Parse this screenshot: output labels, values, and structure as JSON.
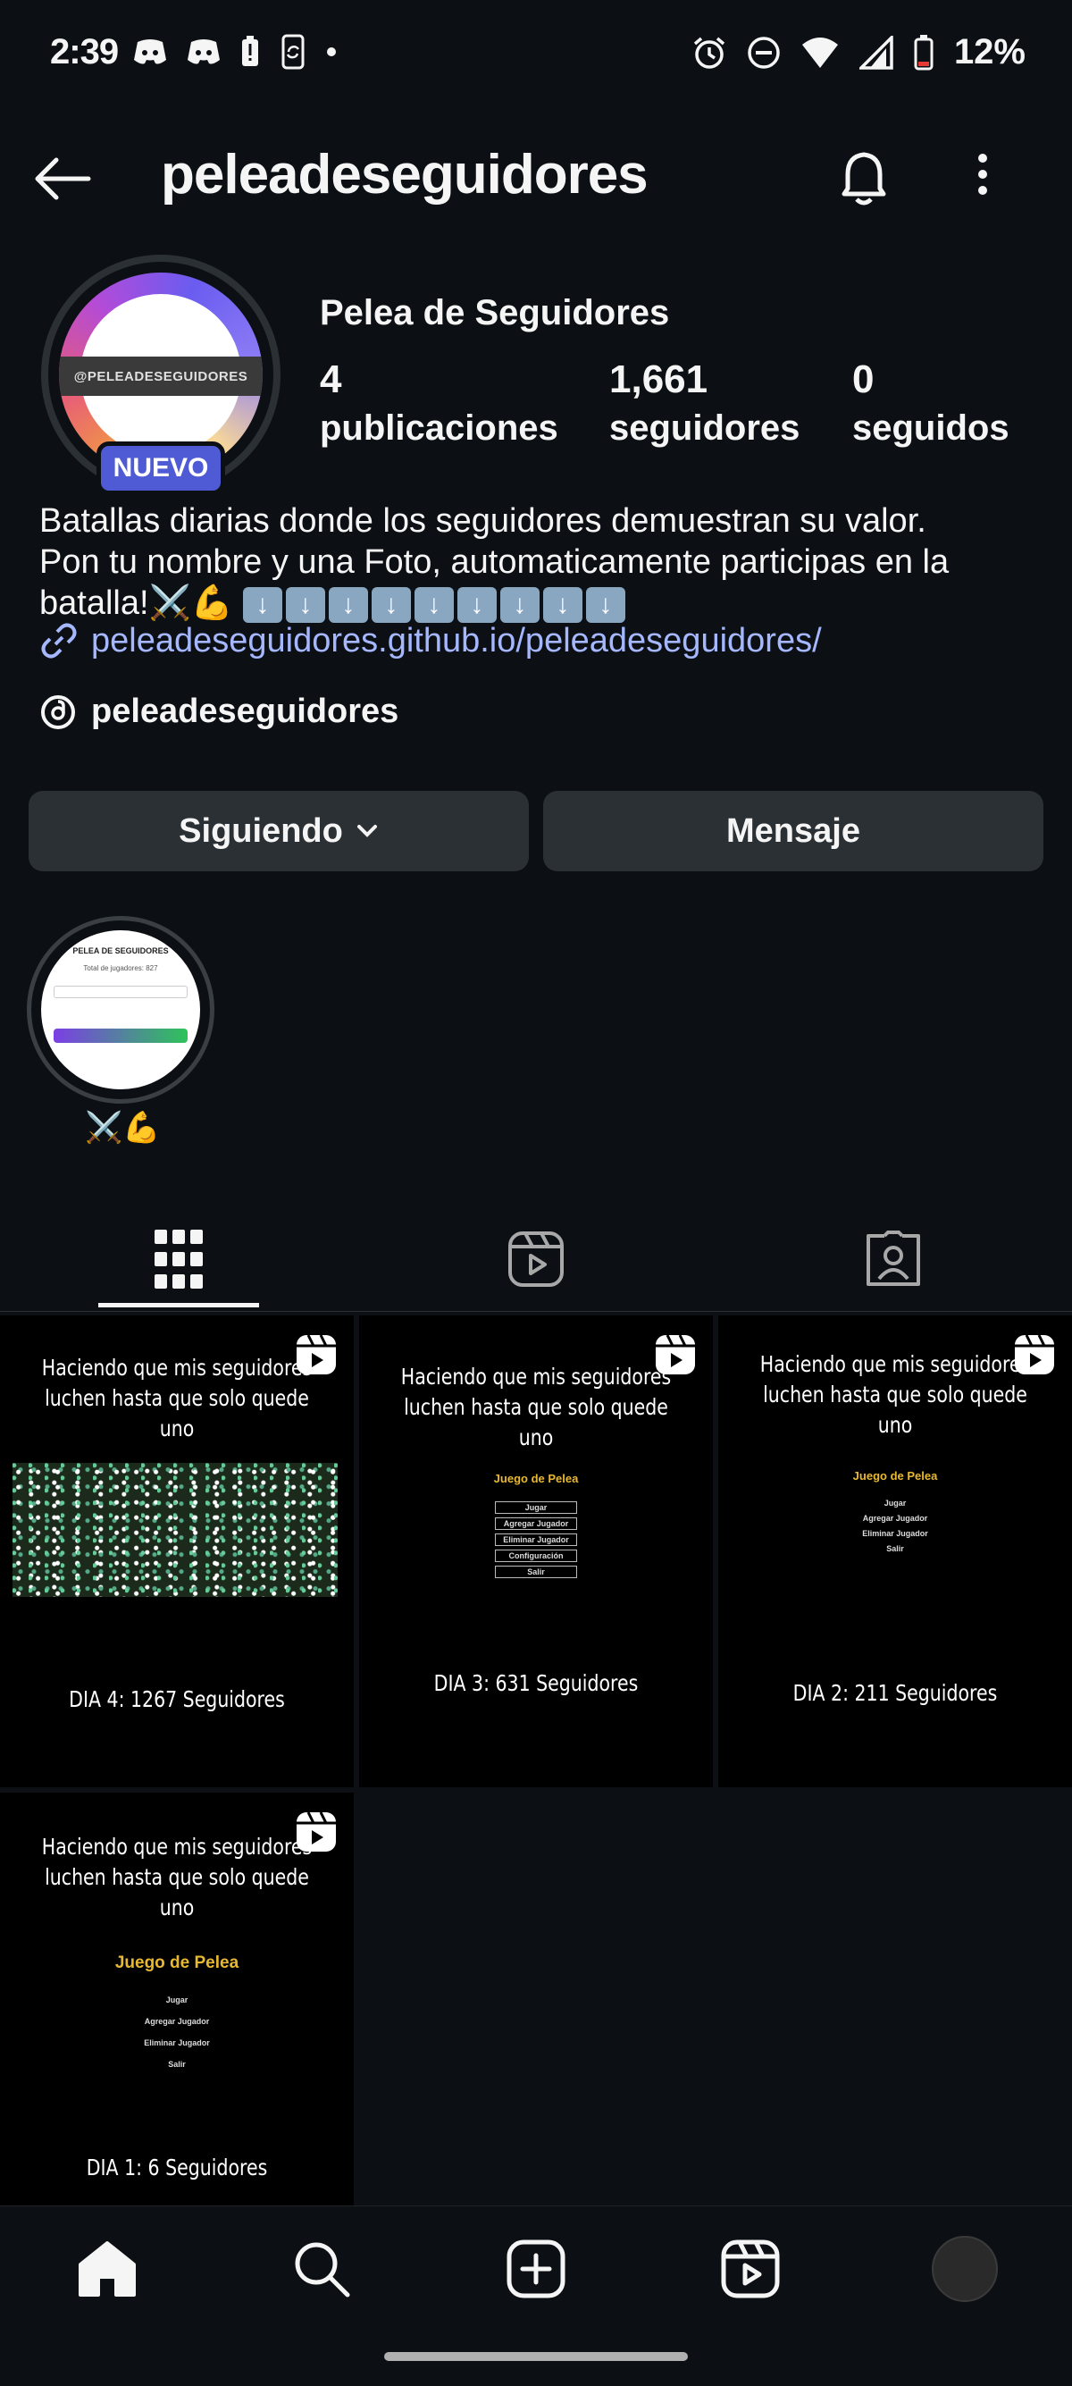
{
  "status_bar": {
    "time": "2:39",
    "battery": "12%"
  },
  "header": {
    "username": "peleadeseguidores"
  },
  "profile": {
    "avatar_text": "@PELEADESEGUIDORES",
    "badge": "NUEVO",
    "display_name": "Pelea de Seguidores",
    "stats": {
      "posts_count": "4",
      "posts_label": "publicaciones",
      "followers_count": "1,661",
      "followers_label": "seguidores",
      "following_count": "0",
      "following_label": "seguidos"
    },
    "bio_line1": "Batallas diarias donde los seguidores demuestran su valor.",
    "bio_line2": "Pon tu nombre y una Foto, automaticamente participas en la",
    "bio_line3": "batalla!",
    "bio_emoji": "⚔️💪",
    "link": "peleadeseguidores.github.io/peleadeseguidores/",
    "threads_handle": "peleadeseguidores"
  },
  "actions": {
    "following_label": "Siguiendo",
    "message_label": "Mensaje"
  },
  "highlight": {
    "title": "PELEA DE SEGUIDORES",
    "subtitle": "Total de jugadores: 827",
    "label": "⚔️💪"
  },
  "tabs": [
    "grid-icon",
    "reels-icon",
    "tagged-icon"
  ],
  "posts": [
    {
      "caption1": "Haciendo que mis seguidores",
      "caption2": "luchen hasta que solo quede uno",
      "footer": "DIA 4: 1267 Seguidores"
    },
    {
      "caption1": "Haciendo que mis seguidores",
      "caption2": "luchen hasta que solo quede uno",
      "footer": "DIA 3: 631 Seguidores",
      "menu_title": "Juego de Pelea",
      "menu": [
        "Jugar",
        "Agregar Jugador",
        "Eliminar Jugador",
        "Configuración",
        "Salir"
      ]
    },
    {
      "caption1": "Haciendo que mis seguidores",
      "caption2": "luchen hasta que solo quede uno",
      "footer": "DIA 2: 211 Seguidores",
      "menu_title": "Juego de Pelea",
      "menu": [
        "Jugar",
        "Agregar Jugador",
        "Eliminar Jugador",
        "Salir"
      ]
    },
    {
      "caption1": "Haciendo que mis seguidores",
      "caption2": "luchen hasta que solo quede uno",
      "footer": "DIA 1: 6 Seguidores",
      "menu_title": "Juego de Pelea",
      "menu": [
        "Jugar",
        "Agregar Jugador",
        "Eliminar Jugador",
        "Salir"
      ]
    }
  ],
  "colors": {
    "background": "#0c1014",
    "button": "#2b3035",
    "link": "#a5b8ff",
    "badge": "#4f5bd5",
    "menu_title": "#e8b830"
  }
}
